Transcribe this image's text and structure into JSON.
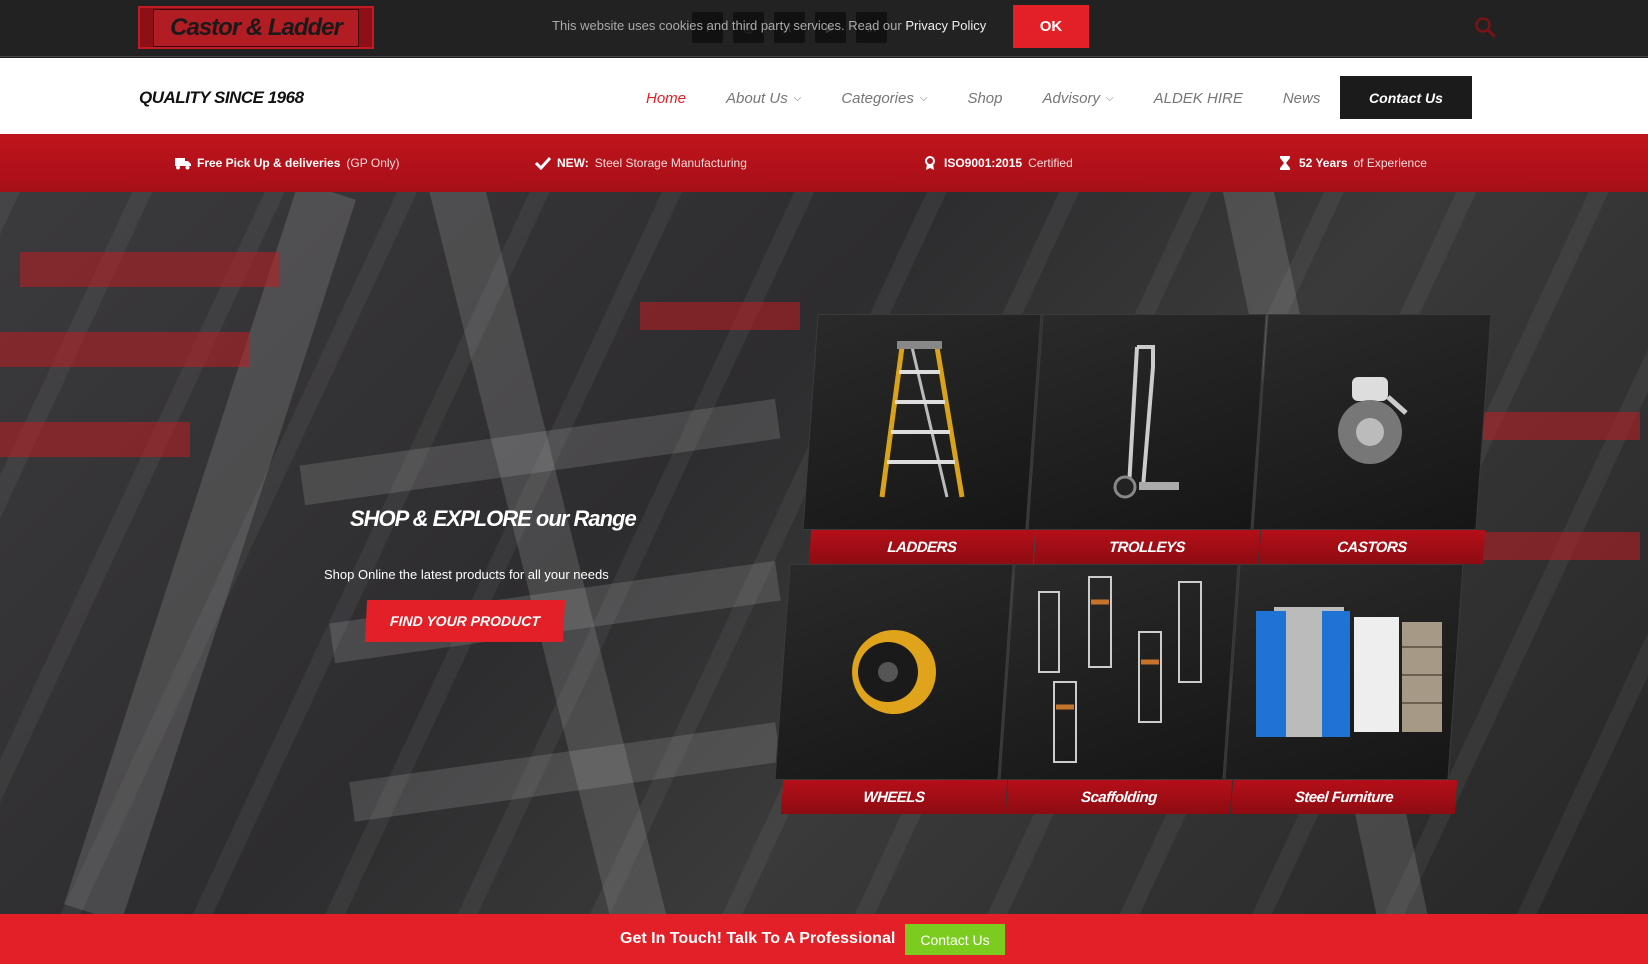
{
  "topbar": {
    "logo_text": "Castor & Ladder",
    "cookie_text": "This website uses cookies and third party services. Read our",
    "cookie_link": "Privacy Policy",
    "ok_label": "OK"
  },
  "navbar": {
    "tagline": "QUALITY SINCE 1968",
    "items": [
      {
        "label": "Home"
      },
      {
        "label": "About Us"
      },
      {
        "label": "Categories"
      },
      {
        "label": "Shop"
      },
      {
        "label": "Advisory"
      },
      {
        "label": "ALDEK HIRE"
      },
      {
        "label": "News"
      }
    ],
    "contact_label": "Contact Us"
  },
  "infostrip": {
    "item1_bold": "Free Pick Up & deliveries",
    "item1_rest": "(GP Only)",
    "item2_bold": "NEW:",
    "item2_rest": "Steel Storage Manufacturing",
    "item3_bold": "ISO9001:2015",
    "item3_rest": "Certified",
    "item4_bold": "52 Years",
    "item4_rest": "of Experience"
  },
  "hero": {
    "title": "SHOP & EXPLORE our Range",
    "subtitle": "Shop Online the latest products for all your needs",
    "button_label": "FIND YOUR PRODUCT"
  },
  "categories": [
    {
      "label": "LADDERS"
    },
    {
      "label": "TROLLEYS"
    },
    {
      "label": "CASTORS"
    },
    {
      "label": "WHEELS"
    },
    {
      "label": "Scaffolding"
    },
    {
      "label": "Steel Furniture"
    }
  ],
  "bottombar": {
    "text": "Get In Touch! Talk To A Professional",
    "button_label": "Contact Us"
  },
  "colors": {
    "brand_red": "#e32027",
    "dark": "#1b1b1b",
    "green": "#7ccc1f"
  }
}
